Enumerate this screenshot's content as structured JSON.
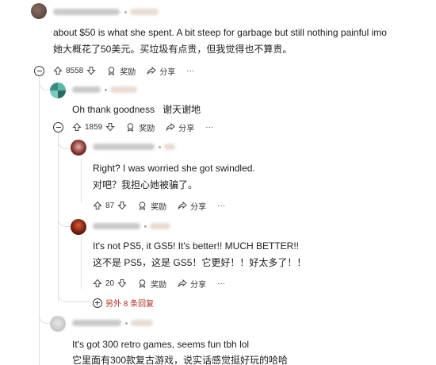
{
  "comments": [
    {
      "id": "c1",
      "text_en": "about $50 is what she spent. A bit steep for garbage but still nothing painful imo",
      "text_zh": "她大概花了50美元。买垃圾有点贵，但我觉得也不算贵。",
      "votes": "8558",
      "award_label": "奖励",
      "share_label": "分享",
      "more_label": "···"
    },
    {
      "id": "c2",
      "text_en": "Oh thank goodness",
      "text_zh": "谢天谢地",
      "votes": "1859",
      "award_label": "奖励",
      "share_label": "分享",
      "more_label": "···"
    },
    {
      "id": "c3",
      "text_en": "Right? I was worried she got swindled.",
      "text_zh": "对吧？我担心她被骗了。",
      "votes": "87",
      "award_label": "奖励",
      "share_label": "分享",
      "more_label": "···"
    },
    {
      "id": "c4",
      "text_en": "It's not PS5, it GS5! It's better!! MUCH BETTER!!",
      "text_zh": "这不是 PS5，这是 GS5！它更好！！好太多了！！",
      "votes": "20",
      "award_label": "奖励",
      "share_label": "分享",
      "more_label": "···"
    },
    {
      "id": "c5",
      "text_en": "It's got 300 retro games, seems fun tbh lol",
      "text_zh": "它里面有300款复古游戏，说实话感觉挺好玩的哈哈"
    }
  ],
  "more_replies": "另外 8 条回复",
  "colors": {
    "accent": "#b5261e",
    "thread_line": "#e0e0e0",
    "text": "#1c1c1c"
  }
}
